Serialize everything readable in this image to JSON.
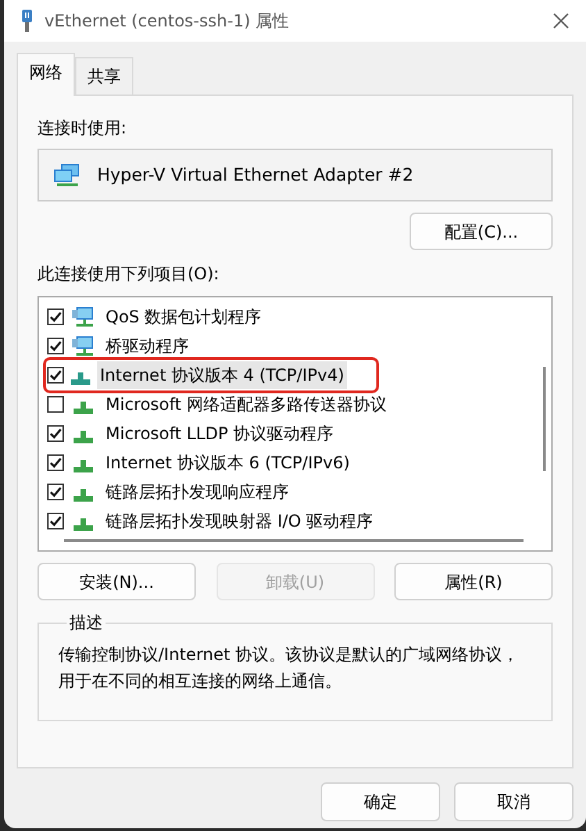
{
  "window": {
    "title": "vEthernet (centos-ssh-1) 属性"
  },
  "tabs": [
    {
      "label": "网络",
      "selected": true
    },
    {
      "label": "共享",
      "selected": false
    }
  ],
  "connect_using": {
    "label": "连接时使用:",
    "adapter": "Hyper-V Virtual Ethernet Adapter #2",
    "configure_button": "配置(C)..."
  },
  "items_label": "此连接使用下列项目(O):",
  "items": [
    {
      "label": "QoS 数据包计划程序",
      "kind": "service",
      "checked": true,
      "selected": false,
      "annotated": false
    },
    {
      "label": "桥驱动程序",
      "kind": "service",
      "checked": true,
      "selected": false,
      "annotated": false
    },
    {
      "label": "Internet 协议版本 4 (TCP/IPv4)",
      "kind": "protocol",
      "checked": true,
      "selected": true,
      "annotated": true
    },
    {
      "label": "Microsoft 网络适配器多路传送器协议",
      "kind": "protocol",
      "checked": false,
      "selected": false,
      "annotated": false
    },
    {
      "label": "Microsoft LLDP 协议驱动程序",
      "kind": "protocol",
      "checked": true,
      "selected": false,
      "annotated": false
    },
    {
      "label": "Internet 协议版本 6 (TCP/IPv6)",
      "kind": "protocol",
      "checked": true,
      "selected": false,
      "annotated": false
    },
    {
      "label": "链路层拓扑发现响应程序",
      "kind": "protocol",
      "checked": true,
      "selected": false,
      "annotated": false
    },
    {
      "label": "链路层拓扑发现映射器 I/O 驱动程序",
      "kind": "protocol",
      "checked": true,
      "selected": false,
      "annotated": false
    }
  ],
  "item_buttons": [
    {
      "label": "安装(N)...",
      "disabled": false
    },
    {
      "label": "卸载(U)",
      "disabled": true
    },
    {
      "label": "属性(R)",
      "disabled": false
    }
  ],
  "description": {
    "legend": "描述",
    "text": "传输控制协议/Internet 协议。该协议是默认的广域网络协议，用于在不同的相互连接的网络上通信。"
  },
  "dialog_buttons": [
    "确定",
    "取消"
  ]
}
